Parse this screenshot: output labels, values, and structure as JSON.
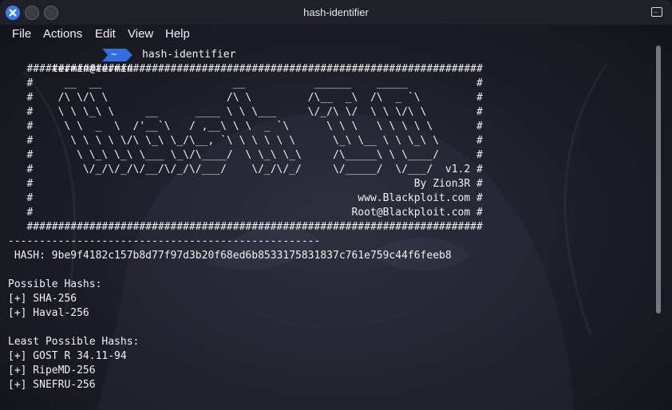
{
  "window": {
    "title": "hash-identifier",
    "accent": "#3d7df0"
  },
  "menu": [
    "File",
    "Actions",
    "Edit",
    "View",
    "Help"
  ],
  "prompt": {
    "user_host": "termin@termin",
    "dir": "~",
    "command": "hash-identifier"
  },
  "banner": [
    "   #########################################################################",
    "   #     __  __                     __           ______    _____           #",
    "   #    /\\ \\/\\ \\                   /\\ \\         /\\__  _\\  /\\  _ `\\         #",
    "   #    \\ \\ \\_\\ \\     __      ____ \\ \\ \\___     \\/_/\\ \\/  \\ \\ \\/\\ \\        #",
    "   #     \\ \\  _  \\  /'__`\\   / ,__\\ \\ \\  _ `\\      \\ \\ \\   \\ \\ \\ \\ \\       #",
    "   #      \\ \\ \\ \\ \\/\\ \\_\\ \\_/\\__, `\\ \\ \\ \\ \\ \\      \\_\\ \\__ \\ \\ \\_\\ \\      #",
    "   #       \\ \\_\\ \\_\\ \\___ \\_\\/\\____/  \\ \\_\\ \\_\\     /\\_____\\ \\ \\____/      #",
    "   #        \\/_/\\/_/\\/__/\\/_/\\/___/    \\/_/\\/_/     \\/_____/  \\/___/  v1.2 #",
    "   #                                                             By Zion3R #",
    "   #                                                    www.Blackploit.com #",
    "   #                                                   Root@Blackploit.com #",
    "   #########################################################################"
  ],
  "separator": "--------------------------------------------------",
  "hash_line": " HASH: 9be9f4182c157b8d77f97d3b20f68ed6b8533175831837c761e759c44f6feeb8",
  "possible_heading": "Possible Hashs:",
  "possible": [
    "[+] SHA-256",
    "[+] Haval-256"
  ],
  "least_heading": "Least Possible Hashs:",
  "least": [
    "[+] GOST R 34.11-94",
    "[+] RipeMD-256",
    "[+] SNEFRU-256"
  ]
}
